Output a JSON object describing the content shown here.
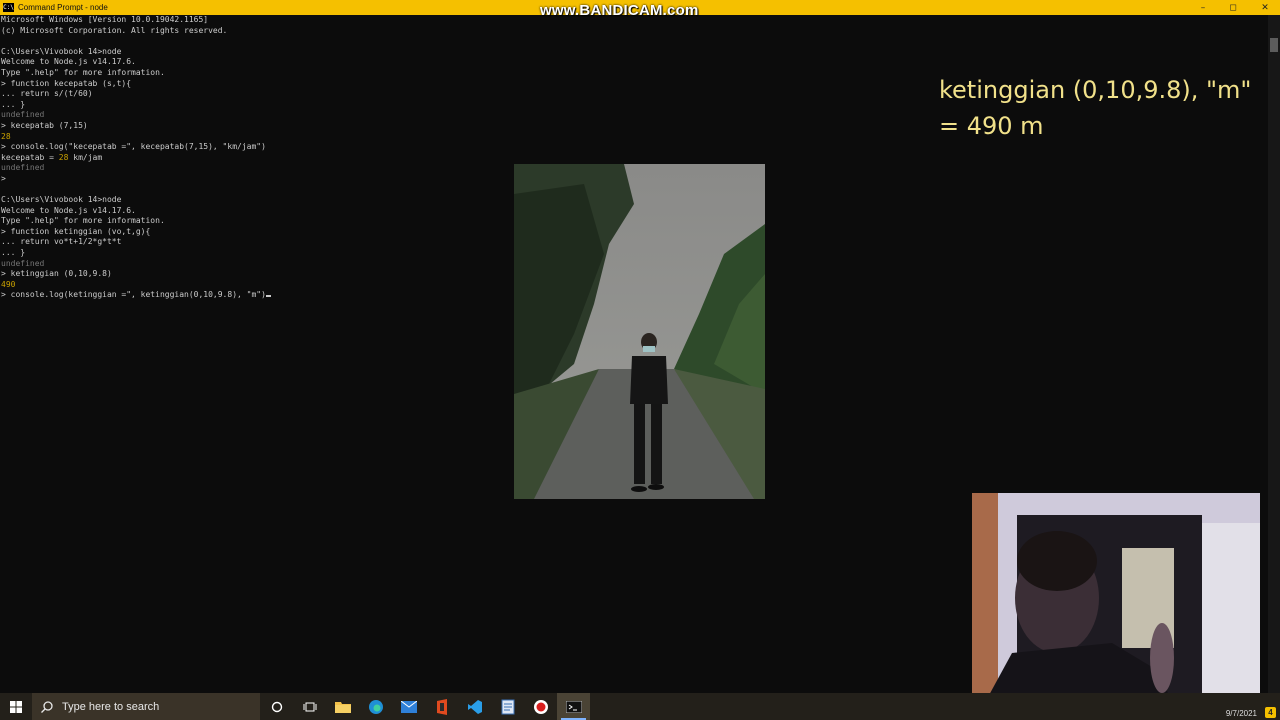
{
  "window": {
    "title": "Command Prompt - node",
    "icon_text": "C:\\"
  },
  "watermark": "www.BANDICAM.com",
  "window_controls": {
    "minimize": "–",
    "maximize": "◻",
    "close": "✕"
  },
  "console_lines": [
    "Microsoft Windows [Version 10.0.19042.1165]",
    "(c) Microsoft Corporation. All rights reserved.",
    "",
    "C:\\Users\\Vivobook 14>node",
    "Welcome to Node.js v14.17.6.",
    "Type \".help\" for more information.",
    "> function kecepatab (s,t){",
    "... return s/(t/60)",
    "... }",
    "undefined",
    "> kecepatab (7,15)",
    "28",
    "> console.log(\"kecepatab =\", kecepatab(7,15), \"km/jam\")",
    "kecepatab = 28 km/jam",
    "undefined",
    ">",
    "",
    "C:\\Users\\Vivobook 14>node",
    "Welcome to Node.js v14.17.6.",
    "Type \".help\" for more information.",
    "> function ketinggian (vo,t,g){",
    "... return vo*t+1/2*g*t*t",
    "... }",
    "undefined",
    "> ketinggian (0,10,9.8)",
    "490",
    "> console.log(ketinggian =\", ketinggian(0,10,9.8), \"m\")"
  ],
  "overlay": {
    "line1": "ketinggian (0,10,9.8), \"m\"",
    "line2": "= 490 m"
  },
  "taskbar": {
    "search_placeholder": "Type here to search",
    "date": "9/7/2021",
    "notification_count": "4"
  },
  "colors": {
    "titlebar": "#f5c000",
    "console_bg": "#0c0c0c",
    "console_text": "#cccccc",
    "undefined_text": "#767676",
    "number_text": "#c9a100",
    "overlay_text": "#f1e18a"
  }
}
